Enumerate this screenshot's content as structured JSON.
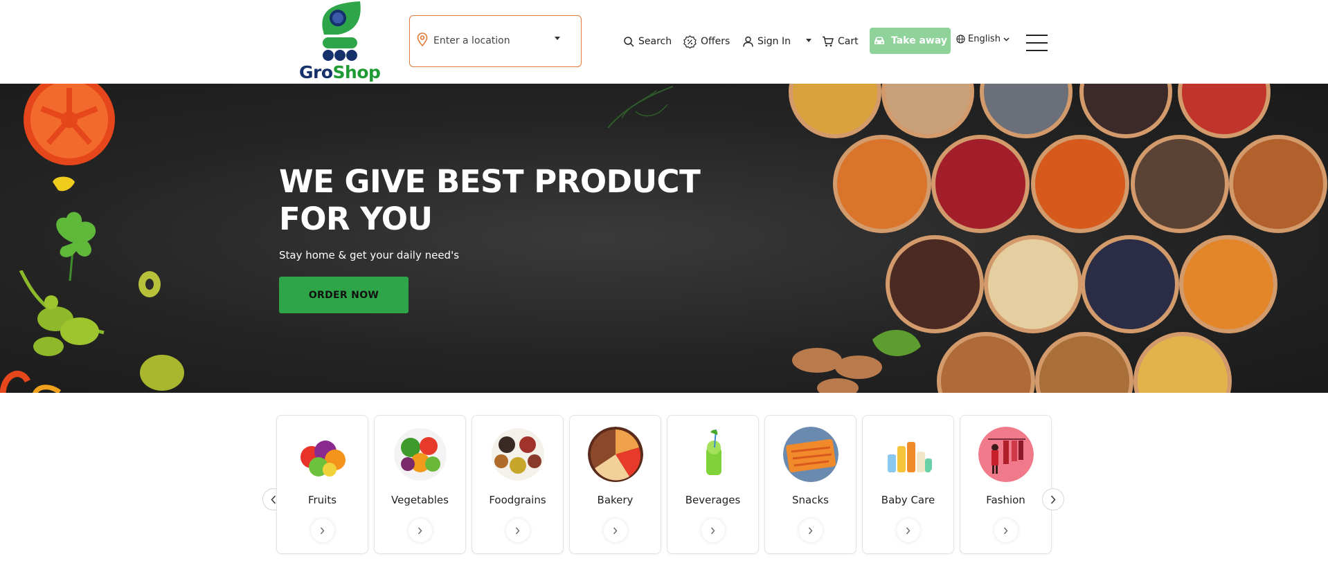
{
  "header": {
    "logo": {
      "name_part1": "Gro",
      "name_part2": "Shop",
      "icon": "cart-leaf-logo"
    },
    "location": {
      "placeholder": "Enter a location",
      "icon": "map-pin-icon"
    },
    "nav": {
      "search_label": "Search",
      "offers_label": "Offers",
      "signin_label": "Sign In",
      "cart_label": "Cart"
    },
    "takeaway_label": "Take away",
    "language_label": "English"
  },
  "hero": {
    "title": "WE GIVE BEST PRODUCT FOR YOU",
    "subtitle": "Stay home & get your daily need's",
    "cta_label": "ORDER NOW"
  },
  "categories": [
    {
      "label": "Fruits"
    },
    {
      "label": "Vegetables"
    },
    {
      "label": "Foodgrains"
    },
    {
      "label": "Bakery"
    },
    {
      "label": "Beverages"
    },
    {
      "label": "Snacks"
    },
    {
      "label": "Baby Care"
    },
    {
      "label": "Fashion"
    }
  ],
  "colors": {
    "brand_green": "#2ea548",
    "brand_navy": "#15306b",
    "takeaway_green": "#8fd29a",
    "location_border": "#e0783a"
  }
}
